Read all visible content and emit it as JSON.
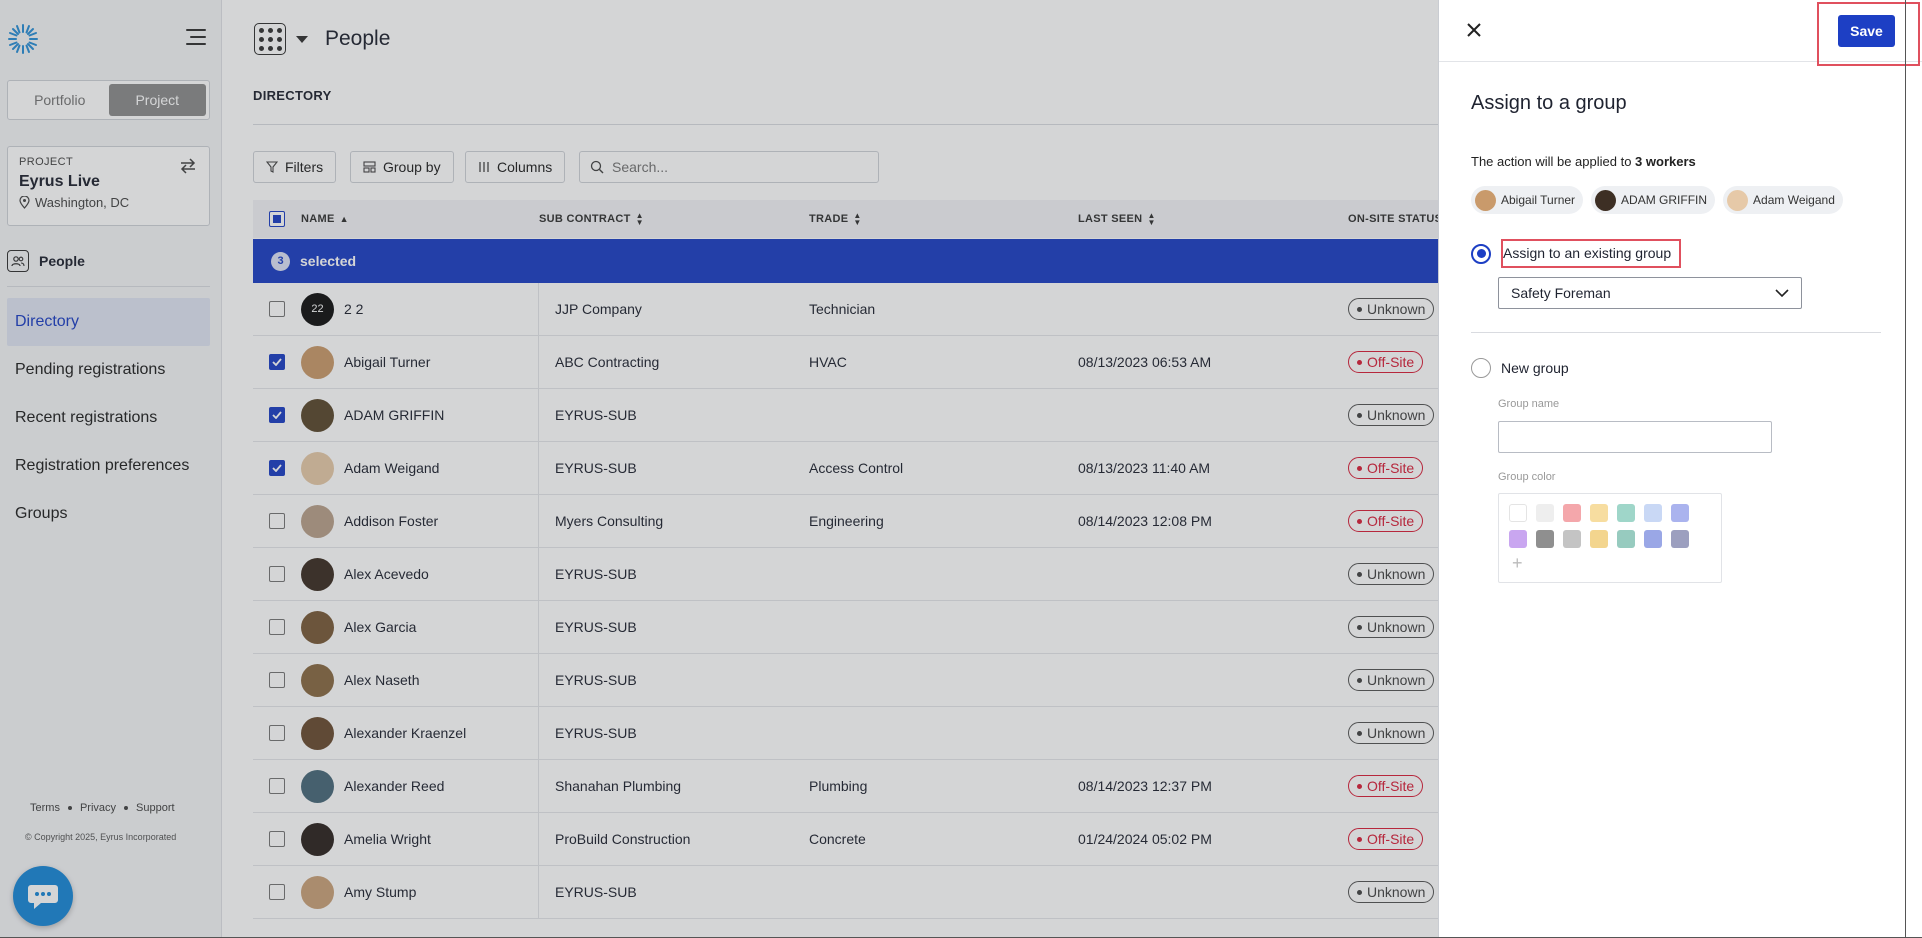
{
  "sidebar": {
    "segment": {
      "portfolio": "Portfolio",
      "project": "Project"
    },
    "project_card": {
      "label": "PROJECT",
      "name": "Eyrus Live",
      "location": "Washington, DC"
    },
    "section": "People",
    "nav": [
      "Directory",
      "Pending registrations",
      "Recent registrations",
      "Registration preferences",
      "Groups"
    ],
    "footer": {
      "terms": "Terms",
      "privacy": "Privacy",
      "support": "Support",
      "copyright": "© Copyright 2025, Eyrus Incorporated"
    }
  },
  "main": {
    "title": "People",
    "section_title": "DIRECTORY",
    "toolbar": {
      "filters": "Filters",
      "group_by": "Group by",
      "columns": "Columns",
      "search_placeholder": "Search..."
    },
    "columns": [
      "NAME",
      "SUB CONTRACT",
      "TRADE",
      "LAST SEEN",
      "ON-SITE STATUS"
    ],
    "selected_count": "3",
    "selected_label": "selected",
    "rows": [
      {
        "name": "2 2",
        "initials": "22",
        "sub": "JJP Company",
        "trade": "Technician",
        "seen": "",
        "status": "Unknown",
        "checked": false
      },
      {
        "name": "Abigail Turner",
        "sub": "ABC Contracting",
        "trade": "HVAC",
        "seen": "08/13/2023 06:53 AM",
        "status": "Off-Site",
        "checked": true
      },
      {
        "name": "ADAM GRIFFIN",
        "sub": "EYRUS-SUB",
        "trade": "",
        "seen": "",
        "status": "Unknown",
        "checked": true
      },
      {
        "name": "Adam Weigand",
        "sub": "EYRUS-SUB",
        "trade": "Access Control",
        "seen": "08/13/2023 11:40 AM",
        "status": "Off-Site",
        "checked": true
      },
      {
        "name": "Addison Foster",
        "sub": "Myers Consulting",
        "trade": "Engineering",
        "seen": "08/14/2023 12:08 PM",
        "status": "Off-Site",
        "checked": false
      },
      {
        "name": "Alex Acevedo",
        "sub": "EYRUS-SUB",
        "trade": "",
        "seen": "",
        "status": "Unknown",
        "checked": false
      },
      {
        "name": "Alex Garcia",
        "sub": "EYRUS-SUB",
        "trade": "",
        "seen": "",
        "status": "Unknown",
        "checked": false
      },
      {
        "name": "Alex Naseth",
        "sub": "EYRUS-SUB",
        "trade": "",
        "seen": "",
        "status": "Unknown",
        "checked": false
      },
      {
        "name": "Alexander Kraenzel",
        "sub": "EYRUS-SUB",
        "trade": "",
        "seen": "",
        "status": "Unknown",
        "checked": false
      },
      {
        "name": "Alexander Reed",
        "sub": "Shanahan Plumbing",
        "trade": "Plumbing",
        "seen": "08/14/2023 12:37 PM",
        "status": "Off-Site",
        "checked": false
      },
      {
        "name": "Amelia Wright",
        "sub": "ProBuild Construction",
        "trade": "Concrete",
        "seen": "01/24/2024 05:02 PM",
        "status": "Off-Site",
        "checked": false
      },
      {
        "name": "Amy Stump",
        "sub": "EYRUS-SUB",
        "trade": "",
        "seen": "",
        "status": "Unknown",
        "checked": false
      }
    ]
  },
  "panel": {
    "save": "Save",
    "title": "Assign to a group",
    "desc_prefix": "The action will be applied to ",
    "desc_count": "3 workers",
    "chips": [
      "Abigail Turner",
      "ADAM GRIFFIN",
      "Adam Weigand"
    ],
    "option_existing": "Assign to an existing group",
    "selected_group": "Safety Foreman",
    "option_new": "New group",
    "group_name_label": "Group name",
    "group_color_label": "Group color",
    "colors_row1": [
      "#ffffff",
      "#eeeeee",
      "#f4a7ab",
      "#f7dda0",
      "#9fd6c9",
      "#c9d8f5",
      "#aab3ee"
    ],
    "colors_row2": [
      "#c9a6f0",
      "#8f8f8f",
      "#c4c4c4",
      "#f3d58e",
      "#97cbbf",
      "#9aa7e6",
      "#9c9fbf"
    ]
  },
  "colors": {
    "accent": "#1d3fc4",
    "offsite": "#d9203a",
    "highlight": "#e0505e"
  }
}
